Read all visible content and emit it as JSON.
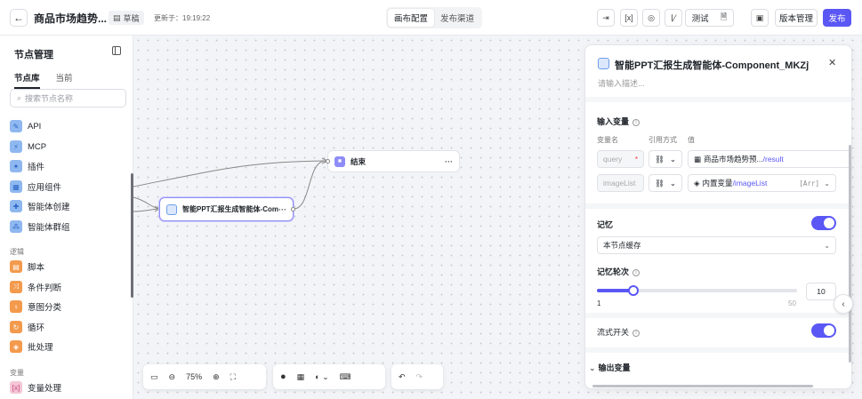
{
  "header": {
    "title": "商品市场趋势...",
    "draft_label": "草稿",
    "updated_text": "更新于：19:19:22",
    "tabs": [
      "画布配置",
      "发布渠道"
    ],
    "test_label": "测试",
    "version_label": "版本管理",
    "publish_label": "发布"
  },
  "sidebar": {
    "title": "节点管理",
    "tabs": [
      "节点库",
      "当前"
    ],
    "search_placeholder": "搜索节点名称",
    "items": [
      {
        "label": "API",
        "icon": "api-icon"
      },
      {
        "label": "MCP",
        "icon": "mcp-icon"
      },
      {
        "label": "插件",
        "icon": "plugin-icon"
      },
      {
        "label": "应用组件",
        "icon": "app-component-icon"
      },
      {
        "label": "智能体创建",
        "icon": "agent-create-icon"
      },
      {
        "label": "智能体群组",
        "icon": "agent-group-icon"
      }
    ],
    "logic_section": "逻辑",
    "logic_items": [
      {
        "label": "脚本",
        "icon": "script-icon"
      },
      {
        "label": "条件判断",
        "icon": "condition-icon"
      },
      {
        "label": "意图分类",
        "icon": "intent-icon"
      },
      {
        "label": "循环",
        "icon": "loop-icon"
      },
      {
        "label": "批处理",
        "icon": "batch-icon"
      }
    ],
    "variable_section": "变量",
    "variable_items": [
      {
        "label": "变量处理",
        "icon": "variable-icon"
      }
    ]
  },
  "canvas": {
    "nodes": {
      "end_label": "结束",
      "component_label": "智能PPT汇报生成智能体-Com...",
      "more": "···"
    },
    "toolbar": {
      "zoom": "75%"
    }
  },
  "panel": {
    "title": "智能PPT汇报生成智能体-Component_MKZj",
    "description_placeholder": "请输入描述...",
    "input_vars_label": "输入变量",
    "col_name": "变量名",
    "col_ref": "引用方式",
    "col_value": "值",
    "vars": [
      {
        "name": "query",
        "value_prefix": "商品市场趋势预...",
        "value_path": "/result"
      },
      {
        "name": "imageList",
        "value_prefix": "内置变量",
        "value_path": "/imageList",
        "type": "[Arr]"
      }
    ],
    "memory_label": "记忆",
    "memory_mode": "本节点缓存",
    "memory_rounds_label": "记忆轮次",
    "memory_rounds": {
      "value": 10,
      "min": 1,
      "max": 50,
      "min_label": "1",
      "max_label": "50",
      "value_text": "10"
    },
    "stream_label": "流式开关",
    "output_vars_label": "输出变量"
  }
}
